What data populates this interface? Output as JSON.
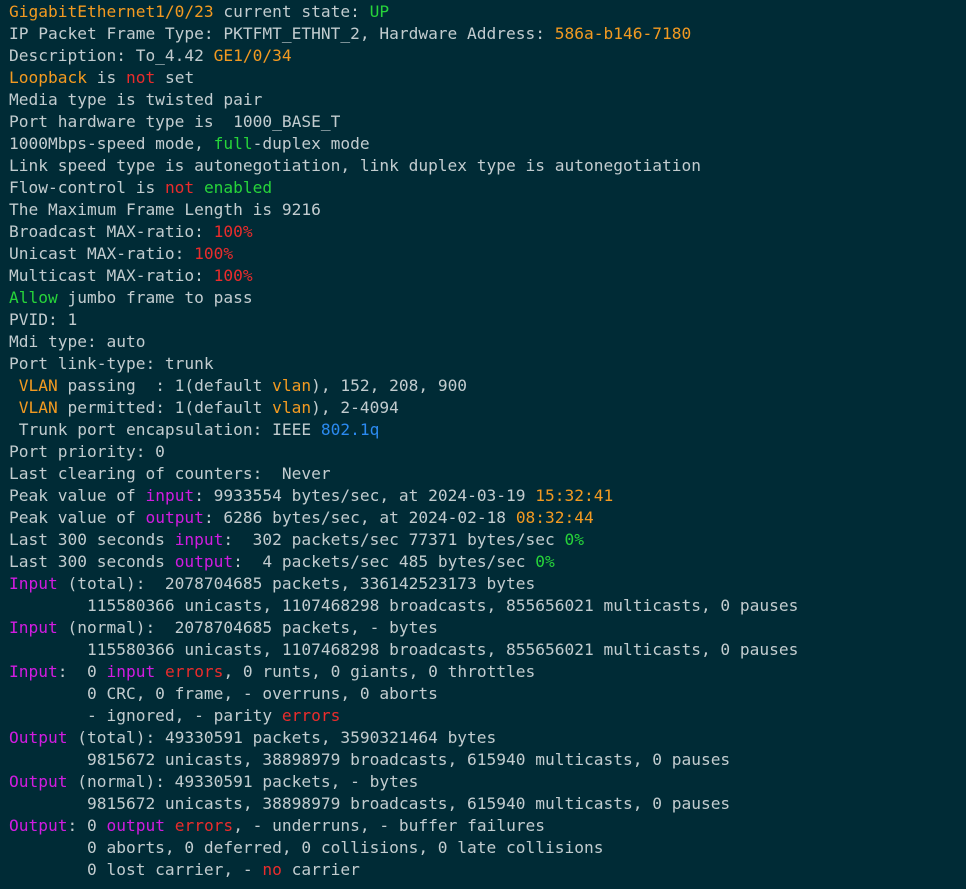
{
  "terminal": {
    "lines": [
      [
        [
          "GigabitEthernet1/0/23",
          "o"
        ],
        [
          " current state: ",
          "d"
        ],
        [
          "UP",
          "g"
        ]
      ],
      [
        [
          "IP Packet Frame Type: PKTFMT_ETHNT_2, Hardware Address: ",
          "d"
        ],
        [
          "586a-b146-7180",
          "o"
        ]
      ],
      [
        [
          "Description: To_4.42 ",
          "d"
        ],
        [
          "GE1/0/34",
          "o"
        ]
      ],
      [
        [
          "Loopback",
          "o"
        ],
        [
          " is ",
          "d"
        ],
        [
          "not",
          "r"
        ],
        [
          " set",
          "d"
        ]
      ],
      [
        [
          "Media type is twisted pair",
          "d"
        ]
      ],
      [
        [
          "Port hardware type is  1000_BASE_T",
          "d"
        ]
      ],
      [
        [
          "1000Mbps-speed mode, ",
          "d"
        ],
        [
          "full",
          "g"
        ],
        [
          "-duplex mode",
          "d"
        ]
      ],
      [
        [
          "Link speed type is autonegotiation, link duplex type is autonegotiation",
          "d"
        ]
      ],
      [
        [
          "Flow-control is ",
          "d"
        ],
        [
          "not",
          "r"
        ],
        [
          " ",
          "d"
        ],
        [
          "enabled",
          "g"
        ]
      ],
      [
        [
          "The Maximum Frame Length is 9216",
          "d"
        ]
      ],
      [
        [
          "Broadcast MAX-ratio: ",
          "d"
        ],
        [
          "100%",
          "r"
        ]
      ],
      [
        [
          "Unicast MAX-ratio: ",
          "d"
        ],
        [
          "100%",
          "r"
        ]
      ],
      [
        [
          "Multicast MAX-ratio: ",
          "d"
        ],
        [
          "100%",
          "r"
        ]
      ],
      [
        [
          "Allow",
          "g"
        ],
        [
          " jumbo frame to pass",
          "d"
        ]
      ],
      [
        [
          "PVID: 1",
          "d"
        ]
      ],
      [
        [
          "Mdi type: auto",
          "d"
        ]
      ],
      [
        [
          "Port link-type: trunk",
          "d"
        ]
      ],
      [
        [
          " ",
          "d"
        ],
        [
          "VLAN",
          "o"
        ],
        [
          " passing  : 1(default ",
          "d"
        ],
        [
          "vlan",
          "o"
        ],
        [
          "), 152, 208, 900",
          "d"
        ]
      ],
      [
        [
          " ",
          "d"
        ],
        [
          "VLAN",
          "o"
        ],
        [
          " permitted: 1(default ",
          "d"
        ],
        [
          "vlan",
          "o"
        ],
        [
          "), 2-4094",
          "d"
        ]
      ],
      [
        [
          " Trunk port encapsulation: IEEE ",
          "d"
        ],
        [
          "802.1q",
          "b"
        ]
      ],
      [
        [
          "Port priority: 0",
          "d"
        ]
      ],
      [
        [
          "Last clearing of counters:  Never",
          "d"
        ]
      ],
      [
        [
          "Peak value of ",
          "d"
        ],
        [
          "input",
          "m"
        ],
        [
          ": 9933554 bytes/sec, at 2024-03-19 ",
          "d"
        ],
        [
          "15:32:41",
          "o"
        ]
      ],
      [
        [
          "Peak value of ",
          "d"
        ],
        [
          "output",
          "m"
        ],
        [
          ": 6286 bytes/sec, at 2024-02-18 ",
          "d"
        ],
        [
          "08:32:44",
          "o"
        ]
      ],
      [
        [
          "Last 300 seconds ",
          "d"
        ],
        [
          "input",
          "m"
        ],
        [
          ":  302 packets/sec 77371 bytes/sec ",
          "d"
        ],
        [
          "0%",
          "g"
        ]
      ],
      [
        [
          "Last 300 seconds ",
          "d"
        ],
        [
          "output",
          "m"
        ],
        [
          ":  4 packets/sec 485 bytes/sec ",
          "d"
        ],
        [
          "0%",
          "g"
        ]
      ],
      [
        [
          "Input",
          "m"
        ],
        [
          " (total):  2078704685 packets, 336142523173 bytes",
          "d"
        ]
      ],
      [
        [
          "        115580366 unicasts, 1107468298 broadcasts, 855656021 multicasts, 0 pauses",
          "d"
        ]
      ],
      [
        [
          "Input",
          "m"
        ],
        [
          " (normal):  2078704685 packets, - bytes",
          "d"
        ]
      ],
      [
        [
          "        115580366 unicasts, 1107468298 broadcasts, 855656021 multicasts, 0 pauses",
          "d"
        ]
      ],
      [
        [
          "Input",
          "m"
        ],
        [
          ":  0 ",
          "d"
        ],
        [
          "input",
          "m"
        ],
        [
          " ",
          "d"
        ],
        [
          "errors",
          "r"
        ],
        [
          ", 0 runts, 0 giants, 0 throttles",
          "d"
        ]
      ],
      [
        [
          "        0 CRC, 0 frame, - overruns, 0 aborts",
          "d"
        ]
      ],
      [
        [
          "        - ignored, - parity ",
          "d"
        ],
        [
          "errors",
          "r"
        ]
      ],
      [
        [
          "Output",
          "m"
        ],
        [
          " (total): 49330591 packets, 3590321464 bytes",
          "d"
        ]
      ],
      [
        [
          "        9815672 unicasts, 38898979 broadcasts, 615940 multicasts, 0 pauses",
          "d"
        ]
      ],
      [
        [
          "Output",
          "m"
        ],
        [
          " (normal): 49330591 packets, - bytes",
          "d"
        ]
      ],
      [
        [
          "        9815672 unicasts, 38898979 broadcasts, 615940 multicasts, 0 pauses",
          "d"
        ]
      ],
      [
        [
          "Output",
          "m"
        ],
        [
          ": 0 ",
          "d"
        ],
        [
          "output",
          "m"
        ],
        [
          " ",
          "d"
        ],
        [
          "errors",
          "r"
        ],
        [
          ", - underruns, - buffer failures",
          "d"
        ]
      ],
      [
        [
          "        0 aborts, 0 deferred, 0 collisions, 0 late collisions",
          "d"
        ]
      ],
      [
        [
          "        0 lost carrier, - ",
          "d"
        ],
        [
          "no",
          "r"
        ],
        [
          " carrier",
          "d"
        ]
      ]
    ]
  }
}
